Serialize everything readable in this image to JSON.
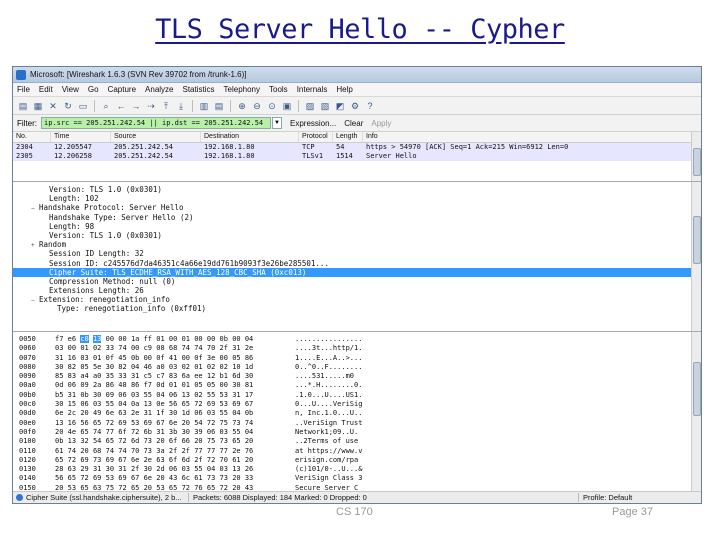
{
  "slide": {
    "title": "TLS Server Hello -- Cypher",
    "footer_left": "CS 170",
    "footer_right": "Page 37"
  },
  "window": {
    "title": "Microsoft: [Wireshark 1.6.3 (SVN Rev 39702 from /trunk-1.6)]"
  },
  "menu": [
    "File",
    "Edit",
    "View",
    "Go",
    "Capture",
    "Analyze",
    "Statistics",
    "Telephony",
    "Tools",
    "Internals",
    "Help"
  ],
  "filter": {
    "label": "Filter:",
    "value": "ip.src == 205.251.242.54 || ip.dst == 205.251.242.54",
    "expression": "Expression...",
    "clear": "Clear",
    "apply": "Apply"
  },
  "packet_list": {
    "columns": [
      "No.",
      "Time",
      "Source",
      "Destination",
      "Protocol",
      "Length",
      "Info"
    ],
    "rows": [
      {
        "no": "2304",
        "time": "12.205547",
        "src": "205.251.242.54",
        "dst": "192.168.1.80",
        "proto": "TCP",
        "len": "54",
        "info": "https > 54970 [ACK] Seq=1 Ack=215 Win=6912 Len=0"
      },
      {
        "no": "2305",
        "time": "12.206258",
        "src": "205.251.242.54",
        "dst": "192.168.1.80",
        "proto": "TLSv1",
        "len": "1514",
        "info": "Server Hello"
      }
    ]
  },
  "details": [
    {
      "text": "Version: TLS 1.0 (0x0301)",
      "indent": 1,
      "exp": ""
    },
    {
      "text": "Length: 102",
      "indent": 1,
      "exp": ""
    },
    {
      "text": "Handshake Protocol: Server Hello",
      "indent": 0,
      "exp": "−"
    },
    {
      "text": "Handshake Type: Server Hello (2)",
      "indent": 1,
      "exp": ""
    },
    {
      "text": "Length: 98",
      "indent": 1,
      "exp": ""
    },
    {
      "text": "Version: TLS 1.0 (0x0301)",
      "indent": 1,
      "exp": ""
    },
    {
      "text": "Random",
      "indent": 0,
      "exp": "+"
    },
    {
      "text": "Session ID Length: 32",
      "indent": 1,
      "exp": ""
    },
    {
      "text": "Session ID: c245576d7da46351c4a66e19dd761b9093f3e26be285501...",
      "indent": 1,
      "exp": ""
    },
    {
      "text": "Cipher Suite: TLS_ECDHE_RSA_WITH_AES_128_CBC_SHA (0xc013)",
      "indent": 1,
      "exp": "",
      "selected": true
    },
    {
      "text": "Compression Method: null (0)",
      "indent": 1,
      "exp": ""
    },
    {
      "text": "Extensions Length: 26",
      "indent": 1,
      "exp": ""
    },
    {
      "text": "Extension: renegotiation_info",
      "indent": 0,
      "exp": "−"
    },
    {
      "text": "Type: renegotiation_info (0xff01)",
      "indent": 2,
      "exp": ""
    }
  ],
  "hex": [
    {
      "off": "0050",
      "bytes": [
        "f7",
        "e6",
        "c0",
        "13",
        "00",
        "00",
        "1a",
        "ff",
        "01",
        "00",
        "01",
        "00",
        "00",
        "0b",
        "00",
        "04"
      ],
      "ascii": "................",
      "hl": [
        2,
        3
      ]
    },
    {
      "off": "0060",
      "bytes": [
        "03",
        "00",
        "01",
        "02",
        "33",
        "74",
        "00",
        "c9",
        "08",
        "68",
        "74",
        "74",
        "70",
        "2f",
        "31",
        "2e"
      ],
      "ascii": "....3t...http/1."
    },
    {
      "off": "0070",
      "bytes": [
        "31",
        "16",
        "03",
        "01",
        "0f",
        "45",
        "0b",
        "00",
        "0f",
        "41",
        "00",
        "0f",
        "3e",
        "00",
        "05",
        "86"
      ],
      "ascii": "1....E...A..>..."
    },
    {
      "off": "0080",
      "bytes": [
        "30",
        "82",
        "05",
        "5e",
        "30",
        "82",
        "04",
        "46",
        "a0",
        "03",
        "02",
        "01",
        "02",
        "02",
        "10",
        "1d"
      ],
      "ascii": "0..^0..F........"
    },
    {
      "off": "0090",
      "bytes": [
        "85",
        "83",
        "a4",
        "a0",
        "35",
        "33",
        "31",
        "c5",
        "c7",
        "83",
        "6a",
        "ee",
        "12",
        "b1",
        "6d",
        "30"
      ],
      "ascii": "....531.....m0"
    },
    {
      "off": "00a0",
      "bytes": [
        "0d",
        "06",
        "09",
        "2a",
        "86",
        "48",
        "86",
        "f7",
        "0d",
        "01",
        "01",
        "05",
        "05",
        "00",
        "30",
        "81"
      ],
      "ascii": "...*.H........0."
    },
    {
      "off": "00b0",
      "bytes": [
        "b5",
        "31",
        "0b",
        "30",
        "09",
        "06",
        "03",
        "55",
        "04",
        "06",
        "13",
        "02",
        "55",
        "53",
        "31",
        "17"
      ],
      "ascii": ".1.0...U....US1."
    },
    {
      "off": "00c0",
      "bytes": [
        "30",
        "15",
        "06",
        "03",
        "55",
        "04",
        "0a",
        "13",
        "0e",
        "56",
        "65",
        "72",
        "69",
        "53",
        "69",
        "67"
      ],
      "ascii": "0...U....VeriSig"
    },
    {
      "off": "00d0",
      "bytes": [
        "6e",
        "2c",
        "20",
        "49",
        "6e",
        "63",
        "2e",
        "31",
        "1f",
        "30",
        "1d",
        "06",
        "03",
        "55",
        "04",
        "0b"
      ],
      "ascii": "n, Inc.1.0...U.."
    },
    {
      "off": "00e0",
      "bytes": [
        "13",
        "16",
        "56",
        "65",
        "72",
        "69",
        "53",
        "69",
        "67",
        "6e",
        "20",
        "54",
        "72",
        "75",
        "73",
        "74"
      ],
      "ascii": "..VeriSign Trust"
    },
    {
      "off": "00f0",
      "bytes": [
        "20",
        "4e",
        "65",
        "74",
        "77",
        "6f",
        "72",
        "6b",
        "31",
        "3b",
        "30",
        "39",
        "06",
        "03",
        "55",
        "04"
      ],
      "ascii": " Network1;09..U."
    },
    {
      "off": "0100",
      "bytes": [
        "0b",
        "13",
        "32",
        "54",
        "65",
        "72",
        "6d",
        "73",
        "20",
        "6f",
        "66",
        "20",
        "75",
        "73",
        "65",
        "20"
      ],
      "ascii": "..2Terms of use "
    },
    {
      "off": "0110",
      "bytes": [
        "61",
        "74",
        "20",
        "68",
        "74",
        "74",
        "70",
        "73",
        "3a",
        "2f",
        "2f",
        "77",
        "77",
        "77",
        "2e",
        "76"
      ],
      "ascii": "at https://www.v"
    },
    {
      "off": "0120",
      "bytes": [
        "65",
        "72",
        "69",
        "73",
        "69",
        "67",
        "6e",
        "2e",
        "63",
        "6f",
        "6d",
        "2f",
        "72",
        "70",
        "61",
        "20"
      ],
      "ascii": "erisign.com/rpa "
    },
    {
      "off": "0130",
      "bytes": [
        "28",
        "63",
        "29",
        "31",
        "30",
        "31",
        "2f",
        "30",
        "2d",
        "06",
        "03",
        "55",
        "04",
        "03",
        "13",
        "26"
      ],
      "ascii": "(c)101/0-..U...&"
    },
    {
      "off": "0140",
      "bytes": [
        "56",
        "65",
        "72",
        "69",
        "53",
        "69",
        "67",
        "6e",
        "20",
        "43",
        "6c",
        "61",
        "73",
        "73",
        "20",
        "33"
      ],
      "ascii": "VeriSign Class 3"
    },
    {
      "off": "0150",
      "bytes": [
        "20",
        "53",
        "65",
        "63",
        "75",
        "72",
        "65",
        "20",
        "53",
        "65",
        "72",
        "76",
        "65",
        "72",
        "20",
        "43"
      ],
      "ascii": " Secure Server C"
    },
    {
      "off": "0160",
      "bytes": [
        "41",
        "20",
        "2d",
        "20",
        "47",
        "33",
        "30",
        "1e",
        "17",
        "0d",
        "31",
        "30",
        "30",
        "31",
        "32",
        "37"
      ],
      "ascii": "A - G30...100127"
    },
    {
      "off": "0170",
      "bytes": [
        "30",
        "30",
        "30",
        "30",
        "30",
        "30",
        "5a",
        "17",
        "0d",
        "31",
        "31",
        "30",
        "32",
        "32",
        "38"
      ],
      "ascii": "000000Z...110228"
    },
    {
      "off": "0180",
      "bytes": [
        "32",
        "33",
        "35",
        "39",
        "35",
        "39",
        "5a",
        "30",
        "81",
        "96",
        "31",
        "0b",
        "30",
        "09",
        "06",
        "03"
      ],
      "ascii": "235959Z0..1.0..."
    }
  ],
  "status": {
    "field": "Cipher Suite (ssl.handshake.ciphersuite), 2 b...",
    "packets": "Packets: 6088 Displayed: 184 Marked: 0 Dropped: 0",
    "profile": "Profile: Default"
  },
  "icons": [
    "app-icon",
    "open-icon",
    "save-icon",
    "close-icon",
    "reload-icon",
    "print-icon",
    "find-icon",
    "back-icon",
    "forward-icon",
    "goto-icon",
    "top-icon",
    "bottom-icon",
    "colorize-icon",
    "zoom-in-icon",
    "zoom-out-icon",
    "zoom-normal-icon",
    "resize-icon",
    "capture-filter-icon",
    "display-filter-icon",
    "coloring-icon",
    "prefs-icon",
    "help-icon"
  ]
}
